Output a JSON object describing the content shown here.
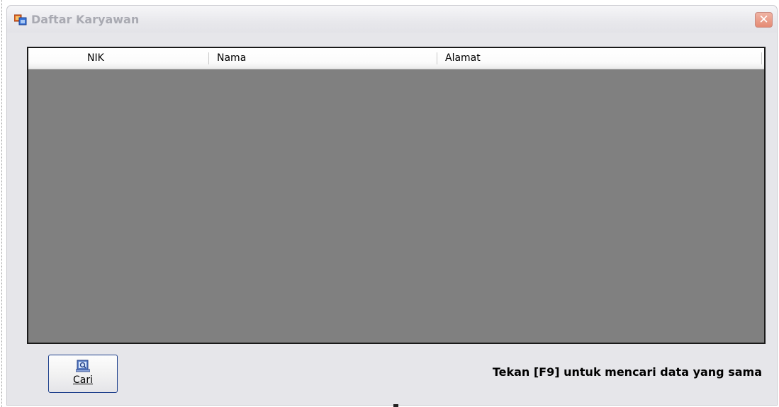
{
  "window": {
    "title": "Daftar Karyawan",
    "icon": "form-window-icon",
    "close_icon": "close-icon"
  },
  "grid": {
    "columns": [
      {
        "label": "NIK"
      },
      {
        "label": "Nama"
      },
      {
        "label": "Alamat"
      }
    ],
    "rows": [],
    "background_color": "#808080"
  },
  "footer": {
    "search_button_label": "Cari",
    "search_button_icon": "search-book-icon",
    "hint_text": "Tekan [F9] untuk mencari data yang sama"
  },
  "colors": {
    "close_button": "#e58a74",
    "button_border": "#1d3f8c",
    "title_text": "#a9aab2"
  }
}
